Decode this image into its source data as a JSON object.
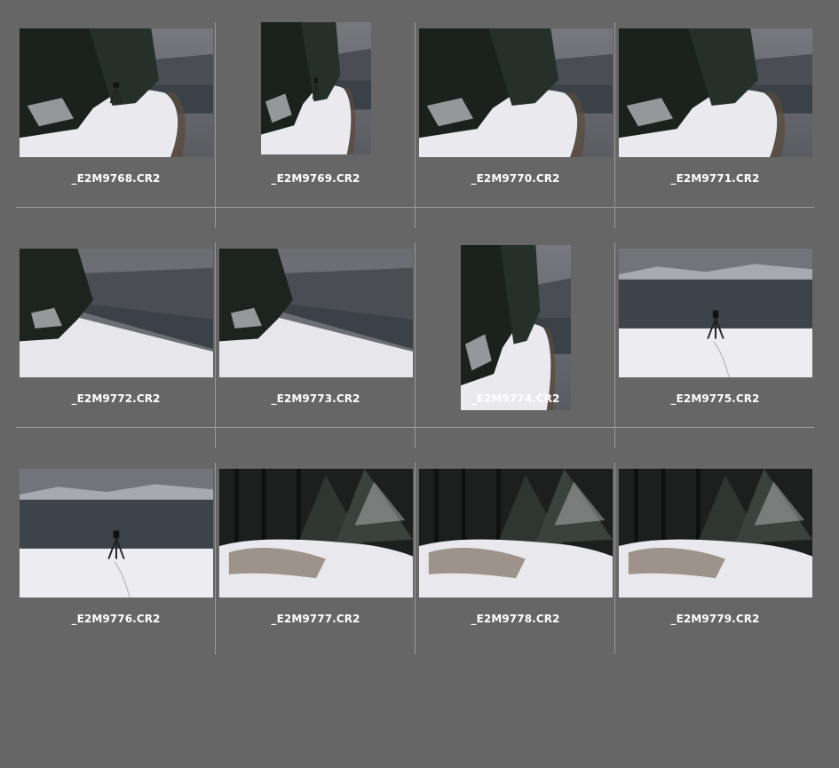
{
  "browser": {
    "background_color": "#666666",
    "divider_color": "#9a9a9a",
    "thumbnails": [
      {
        "filename": "_E2M9768.CR2",
        "orientation": "landscape",
        "scene": "tree-left-lake-tripod"
      },
      {
        "filename": "_E2M9769.CR2",
        "orientation": "narrow",
        "scene": "tree-left-lake-tripod"
      },
      {
        "filename": "_E2M9770.CR2",
        "orientation": "landscape",
        "scene": "tree-left-lake"
      },
      {
        "filename": "_E2M9771.CR2",
        "orientation": "landscape",
        "scene": "tree-left-lake"
      },
      {
        "filename": "_E2M9772.CR2",
        "orientation": "landscape",
        "scene": "diagonal-shore"
      },
      {
        "filename": "_E2M9773.CR2",
        "orientation": "landscape",
        "scene": "diagonal-shore"
      },
      {
        "filename": "_E2M9774.CR2",
        "orientation": "portrait",
        "scene": "tree-left-lake"
      },
      {
        "filename": "_E2M9775.CR2",
        "orientation": "landscape",
        "scene": "lake-tripod"
      },
      {
        "filename": "_E2M9776.CR2",
        "orientation": "landscape",
        "scene": "lake-tripod"
      },
      {
        "filename": "_E2M9777.CR2",
        "orientation": "landscape",
        "scene": "dark-forest"
      },
      {
        "filename": "_E2M9778.CR2",
        "orientation": "landscape",
        "scene": "dark-forest"
      },
      {
        "filename": "_E2M9779.CR2",
        "orientation": "landscape",
        "scene": "dark-forest"
      }
    ]
  }
}
